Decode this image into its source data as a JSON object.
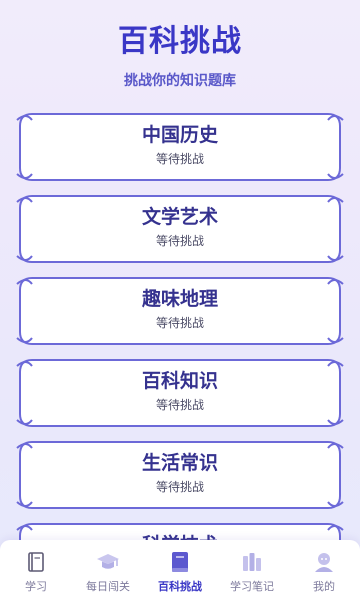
{
  "header": {
    "title": "百科挑战",
    "subtitle": "挑战你的知识题库"
  },
  "categories": [
    {
      "name": "中国历史",
      "status": "等待挑战"
    },
    {
      "name": "文学艺术",
      "status": "等待挑战"
    },
    {
      "name": "趣味地理",
      "status": "等待挑战"
    },
    {
      "name": "百科知识",
      "status": "等待挑战"
    },
    {
      "name": "生活常识",
      "status": "等待挑战"
    },
    {
      "name": "科学技术",
      "status": ""
    }
  ],
  "tabbar": {
    "items": [
      {
        "label": "学习",
        "icon": "book-icon"
      },
      {
        "label": "每日闯关",
        "icon": "graduation-cap-icon"
      },
      {
        "label": "百科挑战",
        "icon": "encyclopedia-icon",
        "active": true
      },
      {
        "label": "学习笔记",
        "icon": "bookshelf-icon"
      },
      {
        "label": "我的",
        "icon": "user-icon"
      }
    ]
  },
  "colors": {
    "accent": "#3a37c6",
    "card_fill": "#ffffff",
    "card_border": "#6c69d8",
    "background": "#eeeafb"
  }
}
